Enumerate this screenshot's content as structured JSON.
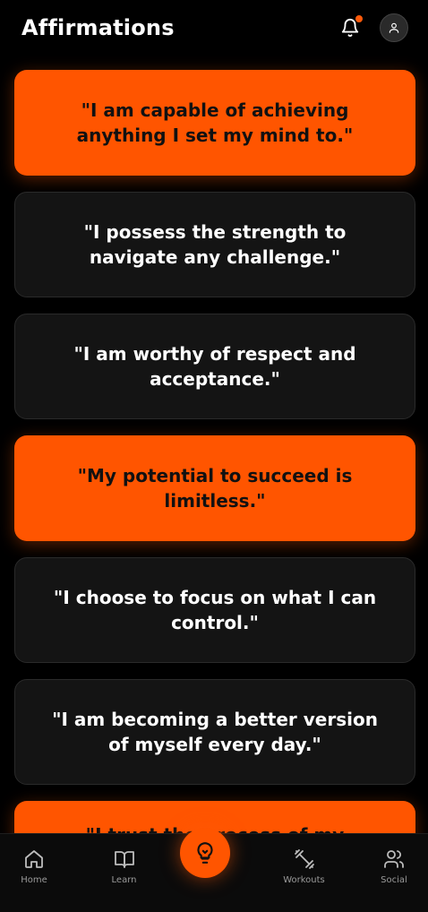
{
  "header": {
    "title": "Affirmations",
    "bell_icon": "bell-icon",
    "profile_icon": "user-icon"
  },
  "colors": {
    "accent": "#ff5500",
    "card_dark": "#141414",
    "background": "#000000"
  },
  "affirmations": [
    {
      "text": "\"I am capable of achieving anything I set my mind to.\"",
      "style": "accent"
    },
    {
      "text": "\"I possess the strength to navigate any challenge.\"",
      "style": "dark"
    },
    {
      "text": "\"I am worthy of respect and acceptance.\"",
      "style": "dark"
    },
    {
      "text": "\"My potential to succeed is limitless.\"",
      "style": "accent"
    },
    {
      "text": "\"I choose to focus on what I can control.\"",
      "style": "dark"
    },
    {
      "text": "\"I am becoming a better version of myself every day.\"",
      "style": "dark"
    },
    {
      "text": "\"I trust the process of my",
      "style": "accent"
    }
  ],
  "nav": {
    "home": "Home",
    "learn": "Learn",
    "workouts": "Workouts",
    "social": "Social",
    "center_icon": "lightbulb-icon"
  }
}
